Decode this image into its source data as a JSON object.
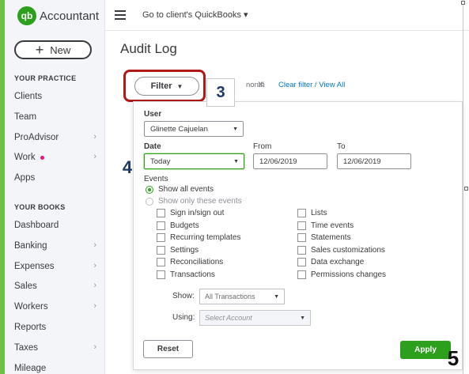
{
  "brand": {
    "logo_text": "qb",
    "name": "Accountant"
  },
  "sidebar": {
    "new_button_label": "New",
    "practice_title": "YOUR PRACTICE",
    "practice_items": [
      {
        "label": "Clients",
        "chevron": false
      },
      {
        "label": "Team",
        "chevron": false
      },
      {
        "label": "ProAdvisor",
        "chevron": true
      },
      {
        "label": "Work",
        "chevron": true,
        "dot": true
      },
      {
        "label": "Apps",
        "chevron": false
      }
    ],
    "books_title": "YOUR BOOKS",
    "books_items": [
      {
        "label": "Dashboard",
        "chevron": false
      },
      {
        "label": "Banking",
        "chevron": true
      },
      {
        "label": "Expenses",
        "chevron": true
      },
      {
        "label": "Sales",
        "chevron": true
      },
      {
        "label": "Workers",
        "chevron": true
      },
      {
        "label": "Reports",
        "chevron": false
      },
      {
        "label": "Taxes",
        "chevron": true
      },
      {
        "label": "Mileage",
        "chevron": false
      }
    ]
  },
  "topbar": {
    "client_link": "Go to client's QuickBooks ▾"
  },
  "page": {
    "title": "Audit Log"
  },
  "filter_bar": {
    "filter_button_label": "Filter",
    "chip_text": "nonth",
    "clear_link": "Clear filter / View All"
  },
  "steps": {
    "s3": "3",
    "s4": "4",
    "s5": "5"
  },
  "filter_panel": {
    "user_label": "User",
    "user_value": "Glinette Cajuelan",
    "date_label": "Date",
    "date_value": "Today",
    "from_label": "From",
    "from_value": "12/06/2019",
    "to_label": "To",
    "to_value": "12/06/2019",
    "events_label": "Events",
    "radio_all": "Show all events",
    "radio_only": "Show only these events",
    "events_left": [
      "Sign in/sign out",
      "Budgets",
      "Recurring templates",
      "Settings",
      "Reconciliations",
      "Transactions"
    ],
    "events_right": [
      "Lists",
      "Time events",
      "Statements",
      "Sales customizations",
      "Data exchange",
      "Permissions changes"
    ],
    "show_label": "Show:",
    "show_value": "All Transactions",
    "using_label": "Using:",
    "using_placeholder": "Select Account",
    "reset_label": "Reset",
    "apply_label": "Apply"
  },
  "colors": {
    "brand_green": "#2ca01c",
    "highlight_red": "#b11818",
    "link_blue": "#0077c5",
    "step_navy": "#1f3864"
  }
}
